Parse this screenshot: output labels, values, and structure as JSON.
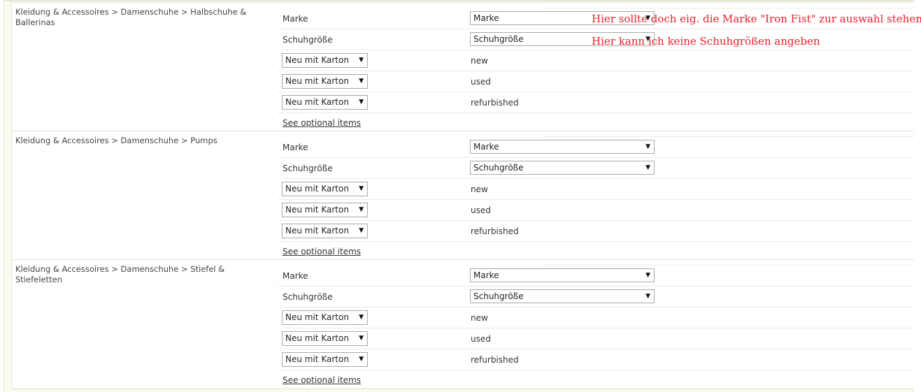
{
  "categories": [
    {
      "name": "Kleidung & Accessoires > Damenschuhe > Halbschuhe & Ballerinas",
      "brand_label": "Marke",
      "brand_select": "Marke",
      "size_label": "Schuhgröße",
      "size_select": "Schuhgröße",
      "conditions": [
        {
          "select": "Neu mit Karton",
          "value": "new"
        },
        {
          "select": "Neu mit Karton",
          "value": "used"
        },
        {
          "select": "Neu mit Karton",
          "value": "refurbished"
        }
      ],
      "optional_link": "See optional items"
    },
    {
      "name": "Kleidung & Accessoires > Damenschuhe > Pumps",
      "brand_label": "Marke",
      "brand_select": "Marke",
      "size_label": "Schuhgröße",
      "size_select": "Schuhgröße",
      "conditions": [
        {
          "select": "Neu mit Karton",
          "value": "new"
        },
        {
          "select": "Neu mit Karton",
          "value": "used"
        },
        {
          "select": "Neu mit Karton",
          "value": "refurbished"
        }
      ],
      "optional_link": "See optional items"
    },
    {
      "name": "Kleidung & Accessoires > Damenschuhe > Stiefel & Stiefeletten",
      "brand_label": "Marke",
      "brand_select": "Marke",
      "size_label": "Schuhgröße",
      "size_select": "Schuhgröße",
      "conditions": [
        {
          "select": "Neu mit Karton",
          "value": "new"
        },
        {
          "select": "Neu mit Karton",
          "value": "used"
        },
        {
          "select": "Neu mit Karton",
          "value": "refurbished"
        }
      ],
      "optional_link": "See optional items"
    }
  ],
  "annotations": {
    "brand_note": "Hier sollte doch eig. die Marke \"Iron Fist\" zur auswahl stehen",
    "size_note": "Hier kann ich keine Schuhgrößen angeben"
  },
  "icons": {
    "dropdown": "caret-down-icon"
  },
  "colors": {
    "annotation": "#e8202a",
    "panel_bg": "#fbfbef"
  }
}
